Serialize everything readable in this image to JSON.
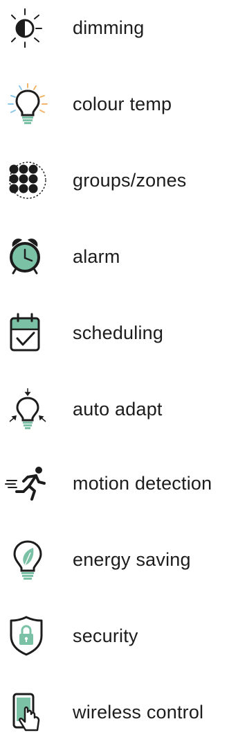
{
  "colors": {
    "ink": "#1c1c1c",
    "accent": "#7bc1a5",
    "warm_ray": "#f2b56b",
    "cool_ray": "#8cc8e8"
  },
  "features": [
    {
      "label": "dimming",
      "icon": "half-sun-icon"
    },
    {
      "label": "colour temp",
      "icon": "bulb-rays-icon"
    },
    {
      "label": "groups/zones",
      "icon": "dot-grid-icon"
    },
    {
      "label": "alarm",
      "icon": "alarm-clock-icon"
    },
    {
      "label": "scheduling",
      "icon": "calendar-check-icon"
    },
    {
      "label": "auto adapt",
      "icon": "bulb-arrows-icon"
    },
    {
      "label": "motion detection",
      "icon": "running-person-icon"
    },
    {
      "label": "energy saving",
      "icon": "bulb-leaf-icon"
    },
    {
      "label": "security",
      "icon": "shield-lock-icon"
    },
    {
      "label": "wireless control",
      "icon": "phone-tap-icon"
    }
  ]
}
